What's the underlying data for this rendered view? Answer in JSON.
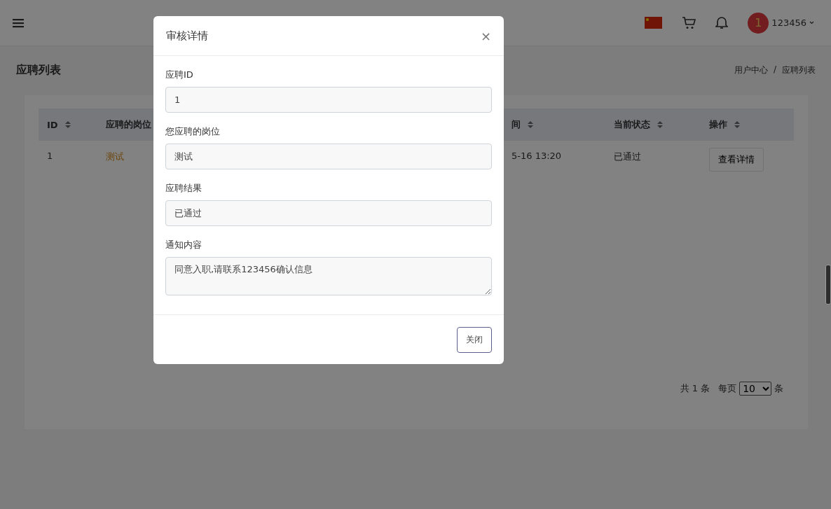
{
  "header": {
    "avatar_badge": "1",
    "username": "123456"
  },
  "page": {
    "title": "应聘列表",
    "breadcrumb": [
      {
        "label": "用户中心"
      },
      {
        "label": "应聘列表"
      }
    ],
    "breadcrumb_separator": "/"
  },
  "table": {
    "columns": [
      {
        "label": "ID",
        "sort_icon": true
      },
      {
        "label": "应聘的岗位"
      },
      {
        "label": "间",
        "sort_icon": true
      },
      {
        "label": "当前状态",
        "sort_icon": true
      },
      {
        "label": "操作",
        "sort_icon": true
      }
    ],
    "rows": [
      {
        "id": "1",
        "position": "测试",
        "time": "5-16 13:20",
        "status": "已通过",
        "action": "查看详情"
      }
    ]
  },
  "pagination": {
    "total": "共 1 条",
    "per_page_label": "每页",
    "per_page": "10",
    "unit": "条"
  },
  "modal": {
    "title": "审核详情",
    "close": "×",
    "fields": [
      {
        "label": "应聘ID",
        "value": "1",
        "kind": "input"
      },
      {
        "label": "您应聘的岗位",
        "value": "测试",
        "kind": "input"
      },
      {
        "label": "应聘结果",
        "value": "已通过",
        "kind": "input"
      },
      {
        "label": "通知内容",
        "value": "同意入职,请联系123456确认信息",
        "kind": "textarea"
      }
    ],
    "button": "关闭"
  }
}
